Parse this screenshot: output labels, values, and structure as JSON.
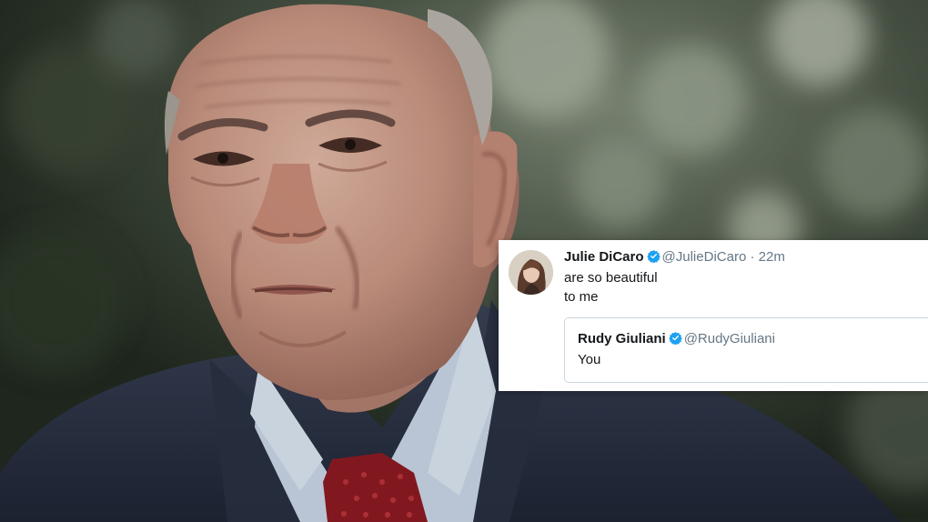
{
  "tweet": {
    "author_name": "Julie DiCaro",
    "author_handle": "@JulieDiCaro",
    "separator": "·",
    "time": "22m",
    "text": "are so beautiful\nto me",
    "quoted": {
      "author_name": "Rudy Giuliani",
      "author_handle": "@RudyGiuliani",
      "text": "You"
    }
  },
  "colors": {
    "verified": "#1da1f2",
    "name": "#14171a",
    "meta": "#657786",
    "card_border": "#ccd6dd"
  },
  "icons": {
    "verified": "verified-badge-icon",
    "avatar": "avatar"
  }
}
